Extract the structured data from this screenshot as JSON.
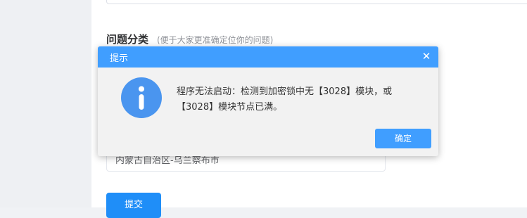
{
  "form": {
    "section_title": "问题分类",
    "section_hint": "(便于大家更准确定位你的问题)",
    "region_value": "内蒙古自治区-乌兰察布市",
    "submit_label": "提交"
  },
  "dialog": {
    "title": "提示",
    "close_glyph": "✕",
    "message": "程序无法启动：检测到加密锁中无【3028】模块，或【3028】模块节点已满。",
    "ok_label": "确定",
    "icon": "info-icon"
  },
  "colors": {
    "accent": "#409eff",
    "submit": "#1f8ef8",
    "dialog_bg": "#f2f2f2"
  }
}
